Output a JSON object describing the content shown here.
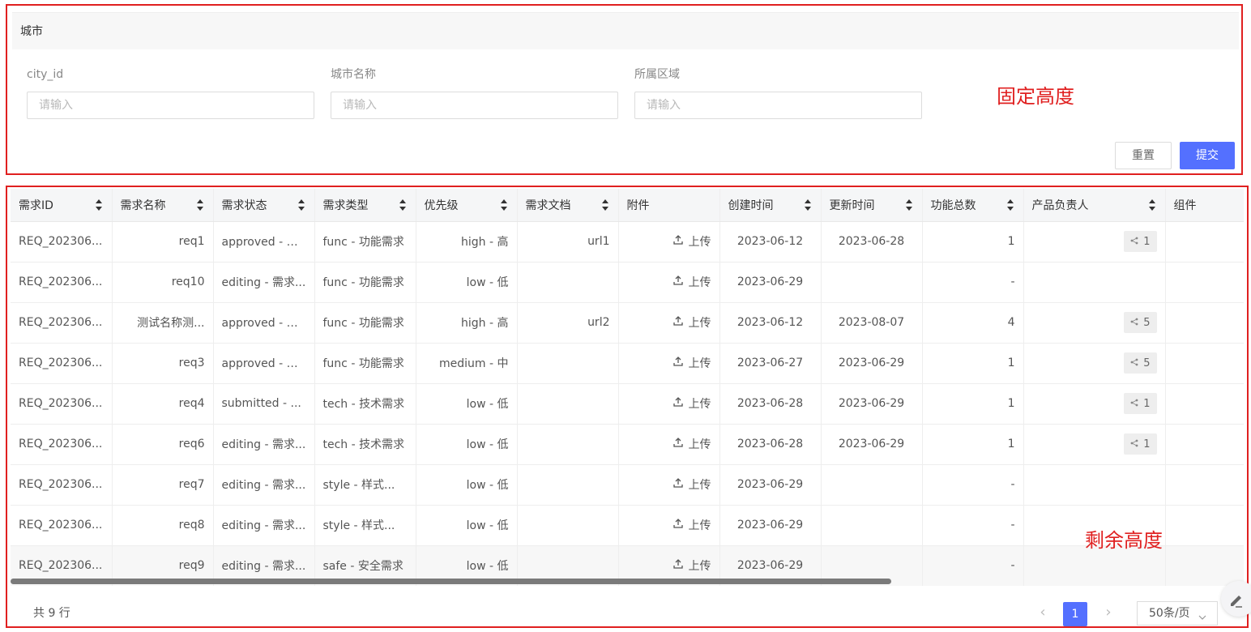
{
  "form": {
    "section_title": "城市",
    "fields": [
      {
        "label": "city_id",
        "placeholder": "请输入"
      },
      {
        "label": "城市名称",
        "placeholder": "请输入"
      },
      {
        "label": "所属区域",
        "placeholder": "请输入"
      }
    ],
    "reset_label": "重置",
    "submit_label": "提交"
  },
  "annotations": {
    "fixed_height": "固定高度",
    "remaining_height": "剩余高度",
    "color": "#e02020"
  },
  "table": {
    "columns": [
      "需求ID",
      "需求名称",
      "需求状态",
      "需求类型",
      "优先级",
      "需求文档",
      "附件",
      "创建时间",
      "更新时间",
      "功能总数",
      "产品负责人",
      "组件"
    ],
    "upload_label": "上传",
    "rows": [
      {
        "id": "REQ_202306...",
        "name": "req1",
        "status": "approved - 已...",
        "type": "func - 功能需求",
        "priority": "high - 高",
        "doc": "url1",
        "created": "2023-06-12",
        "updated": "2023-06-28",
        "features": "1",
        "owner": "1"
      },
      {
        "id": "REQ_202306...",
        "name": "req10",
        "status": "editing - 需求...",
        "type": "func - 功能需求",
        "priority": "low - 低",
        "doc": "",
        "created": "2023-06-29",
        "updated": "",
        "features": "-",
        "owner": ""
      },
      {
        "id": "REQ_202306...",
        "name": "测试名称测...",
        "status": "approved - 已...",
        "type": "func - 功能需求",
        "priority": "high - 高",
        "doc": "url2",
        "created": "2023-06-12",
        "updated": "2023-08-07",
        "features": "4",
        "owner": "5"
      },
      {
        "id": "REQ_202306...",
        "name": "req3",
        "status": "approved - 已...",
        "type": "func - 功能需求",
        "priority": "medium - 中",
        "doc": "",
        "created": "2023-06-27",
        "updated": "2023-06-29",
        "features": "1",
        "owner": "5"
      },
      {
        "id": "REQ_202306...",
        "name": "req4",
        "status": "submitted - ...",
        "type": "tech - 技术需求",
        "priority": "low - 低",
        "doc": "",
        "created": "2023-06-28",
        "updated": "2023-06-29",
        "features": "1",
        "owner": "1"
      },
      {
        "id": "REQ_202306...",
        "name": "req6",
        "status": "editing - 需求...",
        "type": "tech - 技术需求",
        "priority": "low - 低",
        "doc": "",
        "created": "2023-06-28",
        "updated": "2023-06-29",
        "features": "1",
        "owner": "1"
      },
      {
        "id": "REQ_202306...",
        "name": "req7",
        "status": "editing - 需求...",
        "type": "style - 样式...",
        "priority": "low - 低",
        "doc": "",
        "created": "2023-06-29",
        "updated": "",
        "features": "-",
        "owner": ""
      },
      {
        "id": "REQ_202306...",
        "name": "req8",
        "status": "editing - 需求...",
        "type": "style - 样式...",
        "priority": "low - 低",
        "doc": "",
        "created": "2023-06-29",
        "updated": "",
        "features": "-",
        "owner": ""
      },
      {
        "id": "REQ_202306...",
        "name": "req9",
        "status": "editing - 需求...",
        "type": "safe - 安全需求",
        "priority": "low - 低",
        "doc": "",
        "created": "2023-06-29",
        "updated": "",
        "features": "-",
        "owner": ""
      }
    ]
  },
  "pagination": {
    "total": "共 9 行",
    "current_page": "1",
    "page_size": "50条/页"
  },
  "colors": {
    "primary": "#5470ff",
    "annotation": "#e02020"
  }
}
